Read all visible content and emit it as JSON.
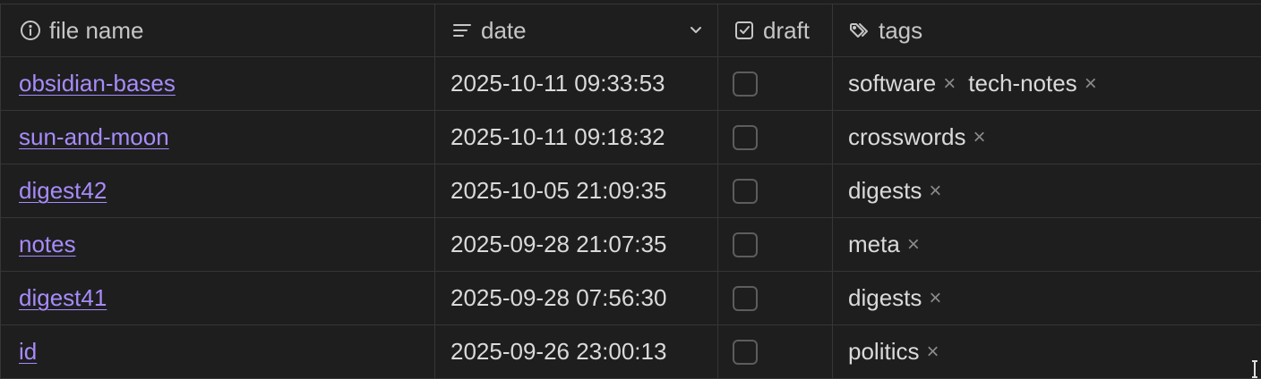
{
  "columns": {
    "file_name": {
      "label": "file name",
      "icon": "info-icon"
    },
    "date": {
      "label": "date",
      "icon": "text-lines-icon"
    },
    "draft": {
      "label": "draft",
      "icon": "checkbox-icon"
    },
    "tags": {
      "label": "tags",
      "icon": "tags-icon"
    }
  },
  "rows": [
    {
      "file_name": "obsidian-bases",
      "date": "2025-10-11 09:33:53",
      "draft": false,
      "tags": [
        "software",
        "tech-notes"
      ]
    },
    {
      "file_name": "sun-and-moon",
      "date": "2025-10-11 09:18:32",
      "draft": false,
      "tags": [
        "crosswords"
      ]
    },
    {
      "file_name": "digest42",
      "date": "2025-10-05 21:09:35",
      "draft": false,
      "tags": [
        "digests"
      ]
    },
    {
      "file_name": "notes",
      "date": "2025-09-28 21:07:35",
      "draft": false,
      "tags": [
        "meta"
      ]
    },
    {
      "file_name": "digest41",
      "date": "2025-09-28 07:56:30",
      "draft": false,
      "tags": [
        "digests"
      ]
    },
    {
      "file_name": "id",
      "date": "2025-09-26 23:00:13",
      "draft": false,
      "tags": [
        "politics"
      ]
    }
  ],
  "colors": {
    "background": "#1e1e1e",
    "border": "#363636",
    "link": "#a78bfa",
    "text": "#dadada"
  },
  "tag_remove_glyph": "×"
}
